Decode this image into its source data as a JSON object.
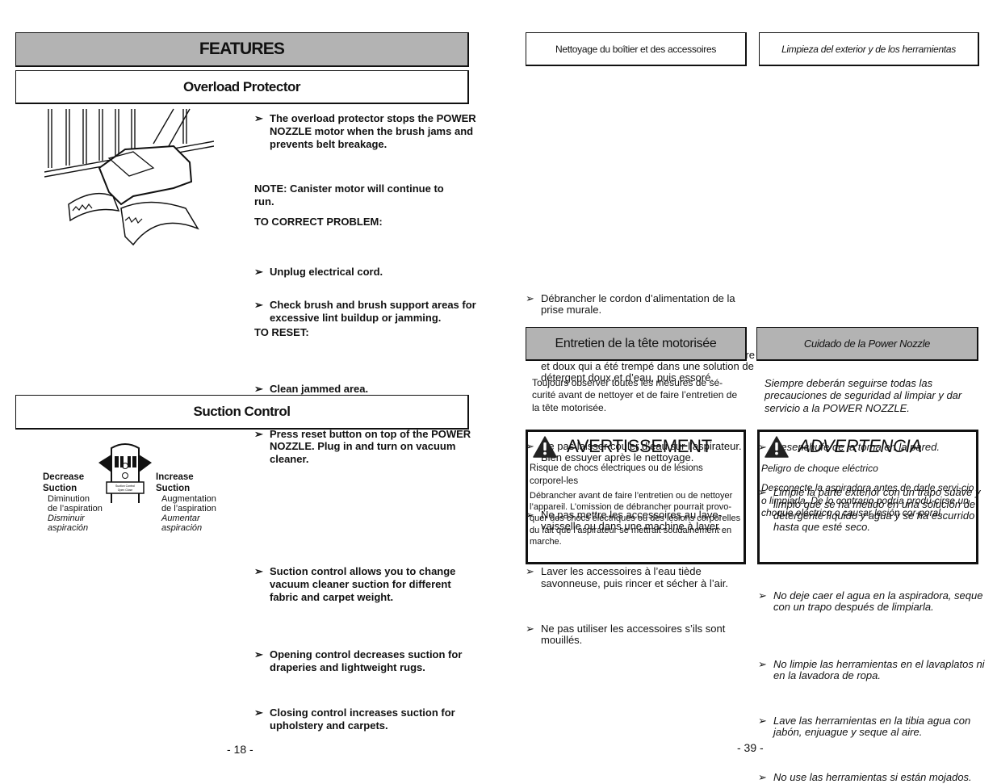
{
  "left_page": {
    "header": "FEATURES",
    "overload": {
      "title": "Overload Protector",
      "intro_bullet": "The overload protector stops the POWER NOZZLE motor when the brush jams and prevents belt breakage.",
      "note": "NOTE:  Canister motor will continue to run.",
      "correct_heading": "TO CORRECT PROBLEM:",
      "correct_steps": [
        "Unplug electrical cord.",
        "Check brush and brush support areas for excessive lint buildup or jamming.",
        "Clean jammed area."
      ],
      "reset_heading": "TO RESET:",
      "reset_step": "Press reset button on top of the POWER NOZZLE. Plug in and turn on vacuum cleaner.",
      "illustration": "power-nozzle-jammed-rug-illustration"
    },
    "suction": {
      "title": "Suction Control",
      "decrease": {
        "en1": "Decrease",
        "en2": "Suction",
        "fr1": "Diminution",
        "fr2": "de l’aspiration",
        "es1": "Disminuir",
        "es2": "aspiración"
      },
      "increase": {
        "en1": "Increase",
        "en2": "Suction",
        "fr1": "Augmentation",
        "fr2": "de l’aspiration",
        "es1": "Aumentar",
        "es2": "aspiración"
      },
      "bullets": [
        "Suction control allows you to change vacuum cleaner suction for different fabric and carpet weight.",
        "Opening control decreases suction for draperies and lightweight rugs.",
        "Closing control increases suction for upholstery and carpets."
      ],
      "illustration": "suction-control-ring-illustration"
    },
    "page_number": "- 18 -"
  },
  "right_page": {
    "fr_cleaning_title": "Nettoyage du boîtier et des accessoires",
    "es_cleaning_title": "Limpieza del exterior y de los herramientas",
    "fr_cleaning_bullets": [
      "Débrancher le cordon d’alimentation de la prise murale.",
      "Nettoyer l’extérieur à l’aide d’un chiffon propre et doux qui a été trempé dans une solution de détergent doux et d’eau, puis essoré.",
      "Ne pas laisser couler d’eau sur l’aspirateur.  Bien essuyer après le nettoyage.",
      "Ne pas mettre les accessoires au lave-vaisselle ou dans une machine à laver.",
      "Laver les accessoires à l’eau tiède savonneuse, puis rincer et sécher à l’air.",
      "Ne pas utiliser les accessoires s’ils sont mouillés."
    ],
    "es_cleaning_bullets": [
      "Desenchufe de la toma en la pared.",
      "Limpie la parte exterior con un trapo suave y limpio que se ha metido en una solución de detergente líquido y agua y se ha escurrido hasta que esté seco.",
      "No deje caer el agua en la aspiradora, seque con un trapo después de limpiarla.",
      "No limpie las herramientas en el lavaplatos ni en la lavadora de ropa.",
      "Lave las herramientas en la tibia agua con jabón, enjuague y seque al aire.",
      "No use las herramientas si están mojados."
    ],
    "fr_nozzle_title": "Entretien de la tête motorisée",
    "es_nozzle_title": "Cuidado de la Power Nozzle",
    "fr_nozzle_text": "Toujours observer toutes les mesures de sé-curité avant de nettoyer et de faire l’entretien de la tête motorisée.",
    "es_nozzle_text": "Siempre deberán seguirse todas las precauciones de seguridad al limpiar y dar servicio a la POWER NOZZLE.",
    "fr_warning": {
      "title": "AVERTISSEMENT",
      "line1": "Risque de chocs électriques ou de lésions corporel-les",
      "line2": "Débrancher avant de faire l’entretien ou de nettoyer l’appareil. L’omission de débrancher pourrait provo-quer des chocs électriques ou des lésions corporelles du fait que l’aspirateur se mettrait soudainement en marche."
    },
    "es_warning": {
      "title": "ADVERTENCIA",
      "line1": "Peligro de choque eléctrico",
      "line2": "Desconecte la aspiradora antes de darle servi-cio o limpiarla.  De lo contrario podría produ-cirse un choque eléctrico o causar lesión cor-poral."
    },
    "page_number": "- 39 -"
  },
  "icons": {
    "bullet": "➢",
    "warning": "warning-triangle-icon"
  },
  "colors": {
    "header_gray": "#b3b3b3",
    "border": "#111111"
  }
}
